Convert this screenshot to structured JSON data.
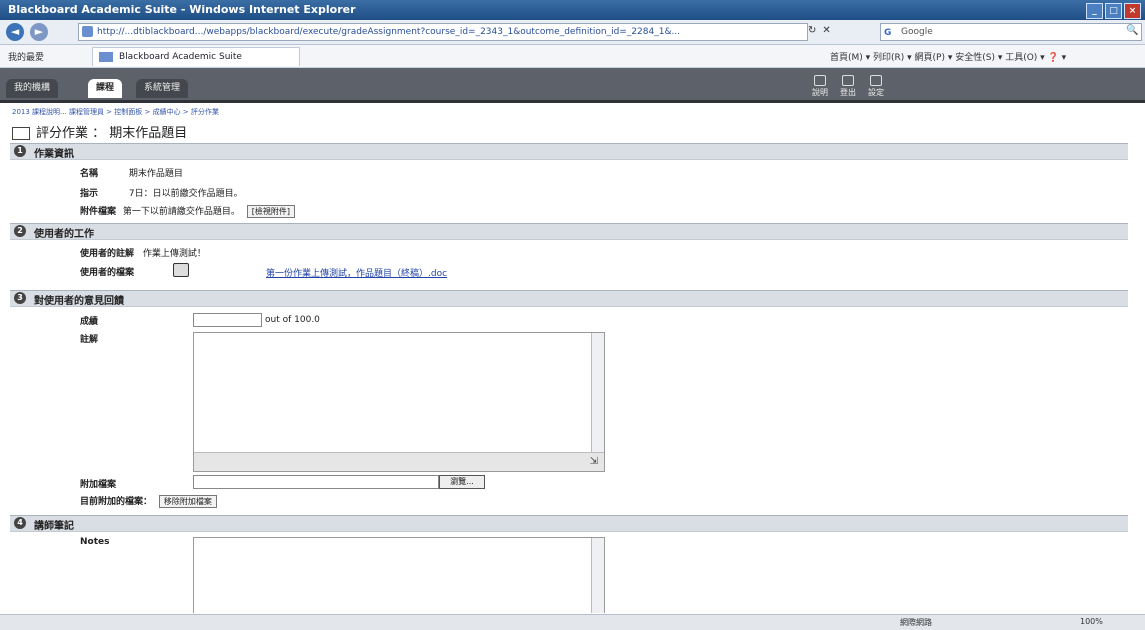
{
  "browser": {
    "title": "Blackboard Academic Suite - Windows Internet Explorer",
    "address": "http://...dtiblackboard.../webapps/blackboard/execute/gradeAssignment?course_id=_2343_1&outcome_definition_id=_2284_1&...",
    "search_placeholder": "Google",
    "favorites_label": "我的最愛",
    "tab_title": "Blackboard Academic Suite",
    "command_bar": "首頁(M) ▾  列印(R) ▾  網頁(P) ▾  安全性(S) ▾  工具(O) ▾  ❓ ▾",
    "window_buttons": [
      "_",
      "□",
      "×"
    ]
  },
  "appbar": {
    "tabs": [
      "我的機構",
      "課程",
      "系統管理"
    ],
    "tools": [
      "說明",
      "登出",
      "設定"
    ]
  },
  "page": {
    "breadcrumb": "2013 課程說明... 課程管理員 > 控制面板 > 成績中心 > 評分作業",
    "title": "評分作業 ： 期末作品題目"
  },
  "sections": [
    {
      "num": "1",
      "label": "作業資訊"
    },
    {
      "num": "2",
      "label": "使用者的工作"
    },
    {
      "num": "3",
      "label": "對使用者的意見回饋"
    },
    {
      "num": "4",
      "label": "講師筆記"
    }
  ],
  "assignment_info": {
    "name_label": "名稱",
    "name_value": "期末作品題目",
    "instructions_label": "指示",
    "instructions_value": "7日：日以前繳交作品題目。",
    "attached_label": "附件檔案",
    "attached_value": "第一下以前請繳交作品題目。",
    "attached_button": "[檢視附件]"
  },
  "user_work": {
    "comments_label": "使用者的註解",
    "comments_value": "作業上傳測試！",
    "files_label": "使用者的檔案",
    "file_link": "第一份作業上傳測試，作品題目（終稿）.doc"
  },
  "feedback": {
    "grade_label": "成績",
    "grade_value": "",
    "grade_suffix": "out of 100.0",
    "comments_label": "註解",
    "attach_label": "附加檔案",
    "browse_button": "瀏覽...",
    "current_file_label": "目前附加的檔案：",
    "remove_button": "移除附加檔案"
  },
  "notes": {
    "notes_label": "Notes"
  },
  "status": {
    "zone": "網際網路",
    "zoom": "100%"
  },
  "colors": {
    "section_bg": "#d9dde4",
    "app_bar": "#5d6169",
    "title_bar": "#1f4e86"
  }
}
